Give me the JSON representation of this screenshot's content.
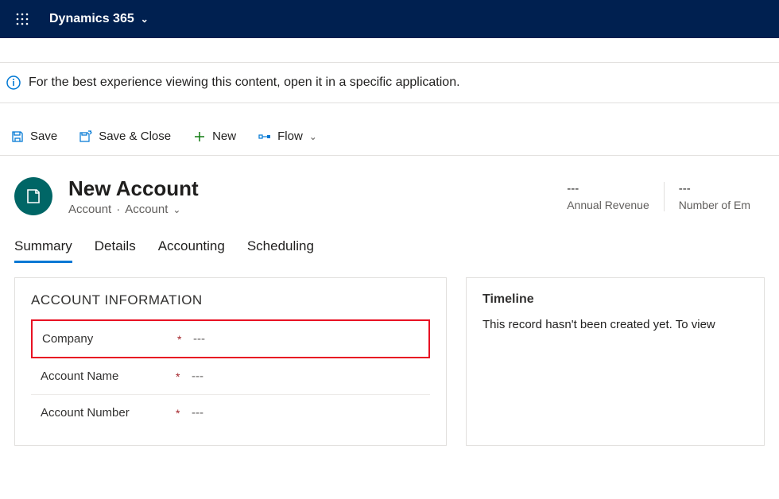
{
  "topNav": {
    "appName": "Dynamics 365"
  },
  "notice": {
    "text": "For the best experience viewing this content, open it in a specific application."
  },
  "commands": {
    "save": "Save",
    "saveClose": "Save & Close",
    "newItem": "New",
    "flow": "Flow"
  },
  "record": {
    "title": "New Account",
    "entityPath1": "Account",
    "entityPath2": "Account"
  },
  "stats": {
    "revenueValue": "---",
    "revenueLabel": "Annual Revenue",
    "employeesValue": "---",
    "employeesLabel": "Number of Em"
  },
  "tabs": {
    "summary": "Summary",
    "details": "Details",
    "accounting": "Accounting",
    "scheduling": "Scheduling"
  },
  "section": {
    "accountInfo": "ACCOUNT INFORMATION",
    "fields": {
      "company": {
        "label": "Company",
        "value": "---"
      },
      "accountName": {
        "label": "Account Name",
        "value": "---"
      },
      "accountNumber": {
        "label": "Account Number",
        "value": "---"
      }
    }
  },
  "timeline": {
    "title": "Timeline",
    "message": "This record hasn't been created yet.  To view "
  }
}
